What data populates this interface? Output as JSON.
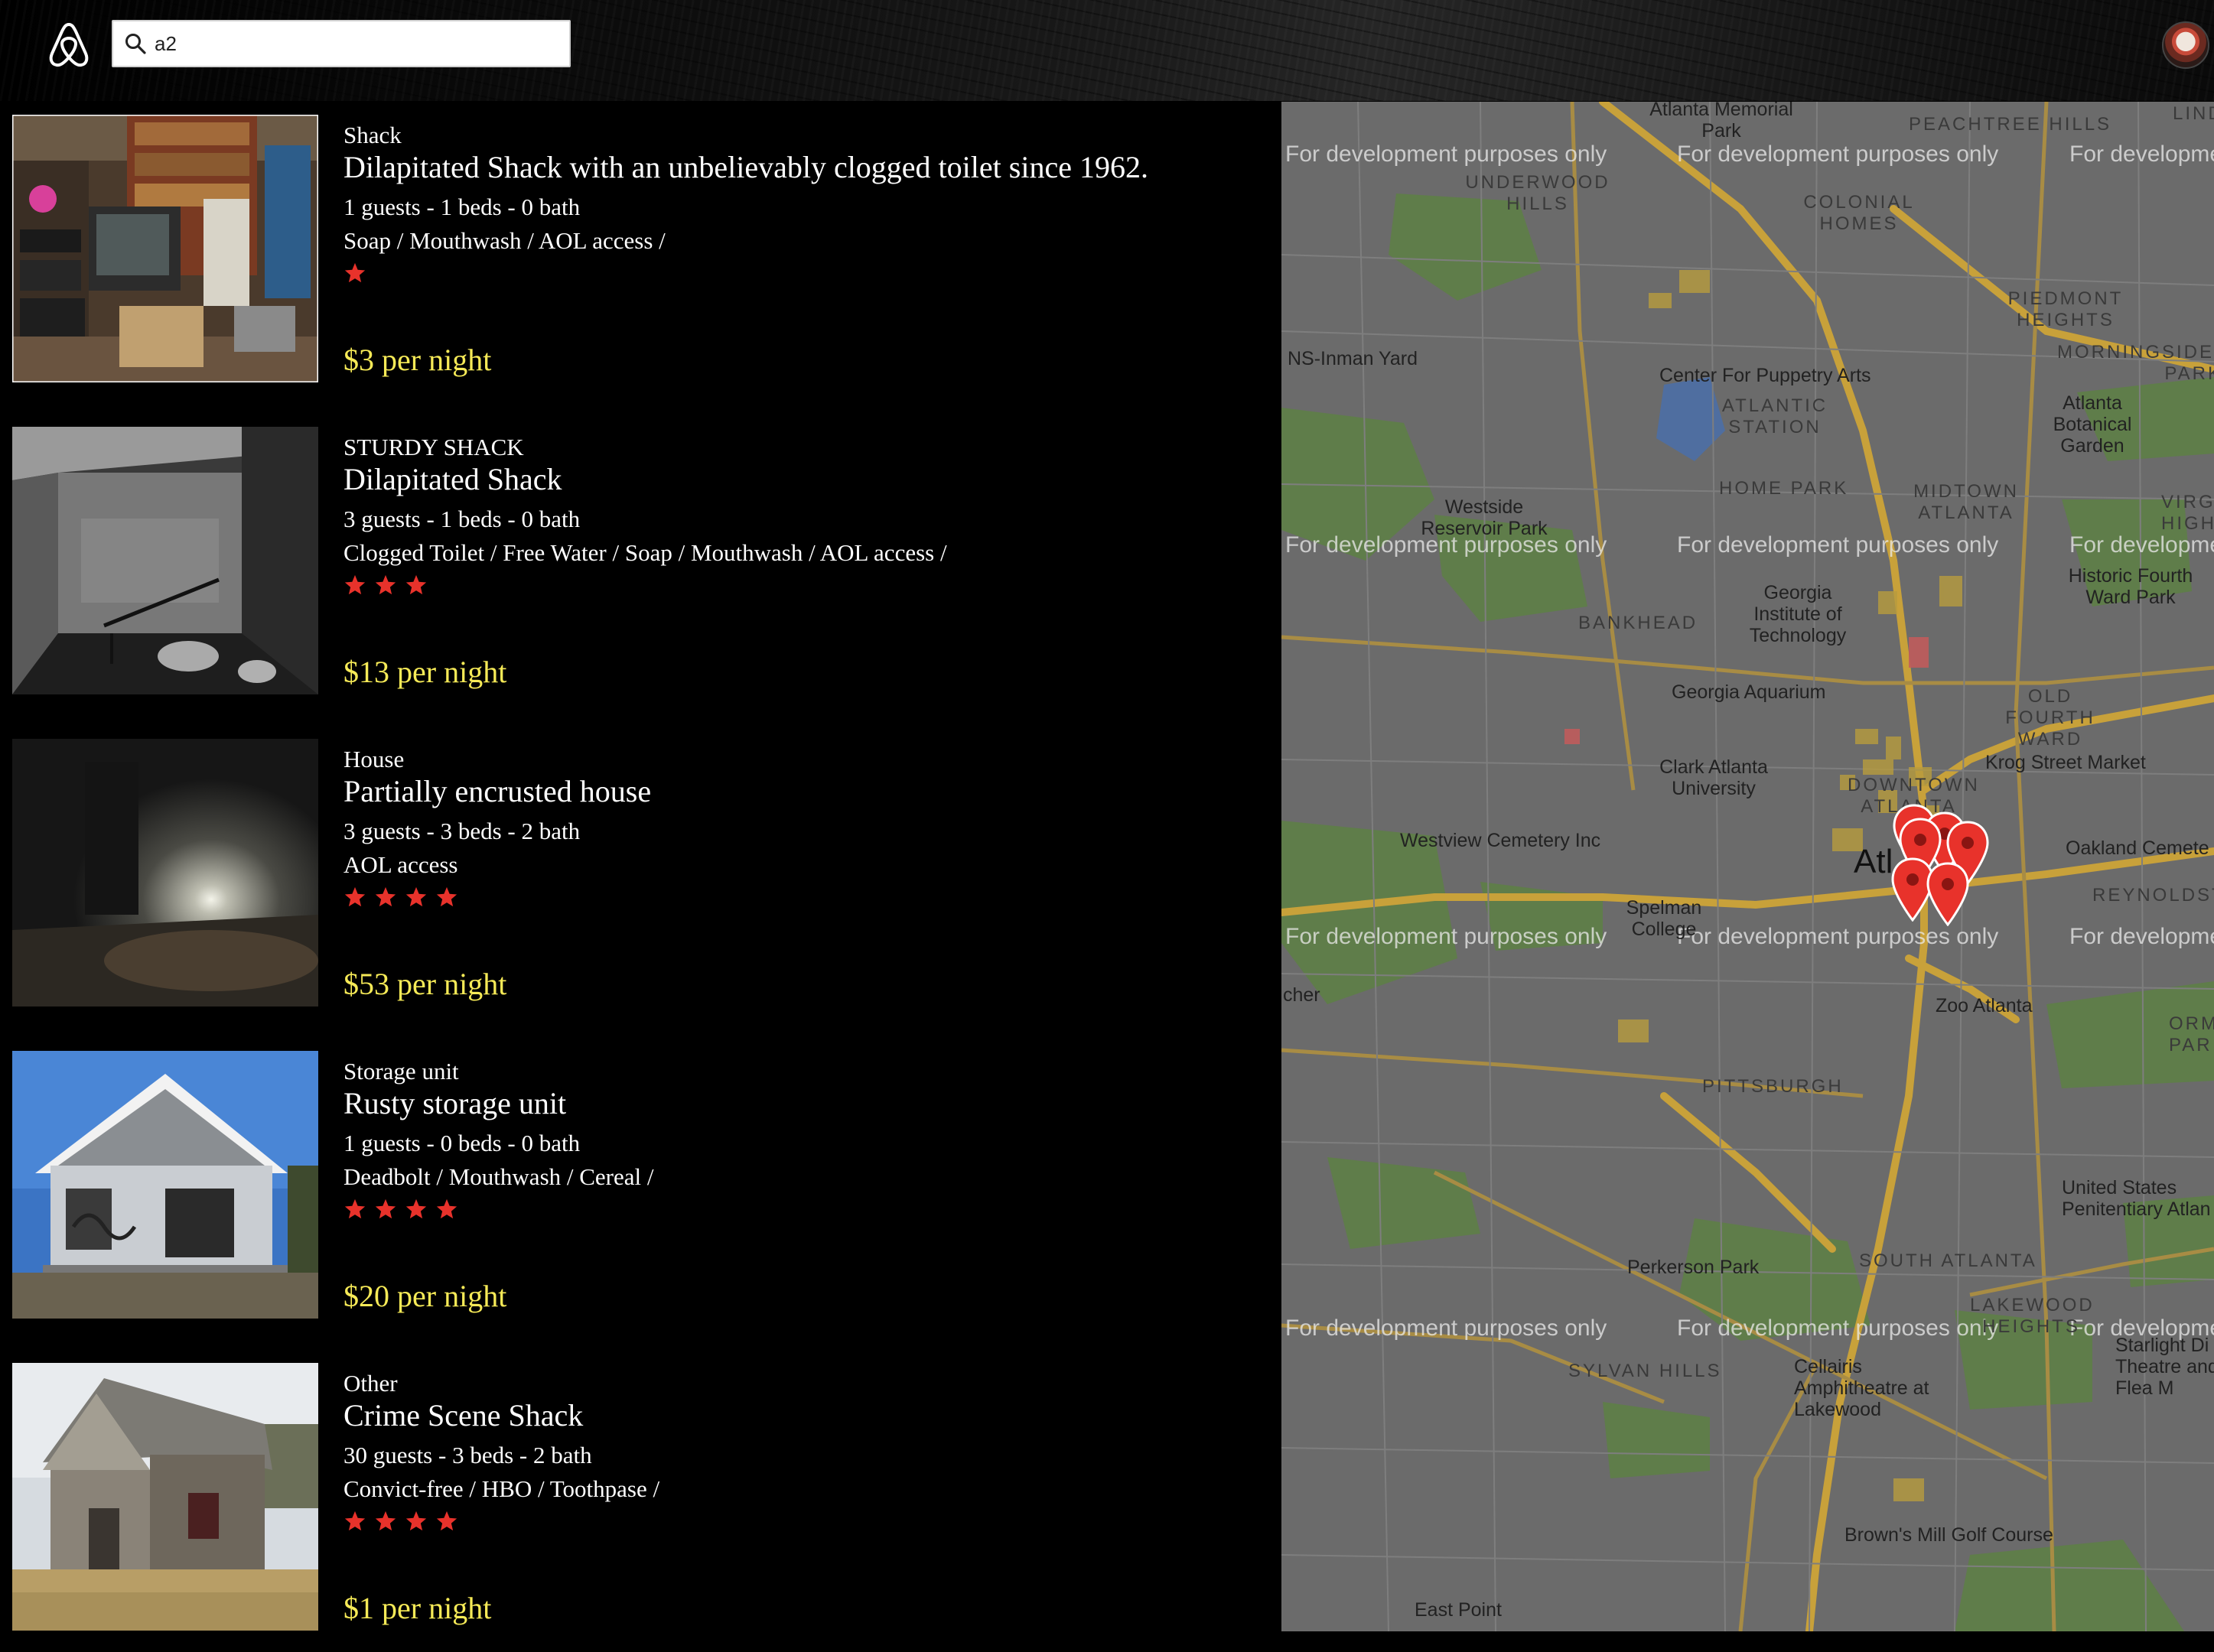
{
  "header": {
    "search": {
      "value": "a2",
      "placeholder": ""
    }
  },
  "icons": {
    "logo": "airbnb-logo-icon",
    "search": "search-icon",
    "avatar": "user-avatar",
    "star": "star-icon",
    "pin": "map-marker-icon"
  },
  "colors": {
    "background": "#000000",
    "price": "#f6ea57",
    "star": "#e8322b",
    "map_base": "#6b6b6b",
    "map_park": "#5f7d4a",
    "map_road": "#c8a13a",
    "pin": "#e8322b"
  },
  "listings": [
    {
      "type": "Shack",
      "title": "Dilapitated Shack with an unbelievably clogged toilet since 1962.",
      "details": "1 guests - 1 beds - 0 bath",
      "amenities": "Soap / Mouthwash / AOL access /",
      "rating": 1,
      "price": "$3 per night",
      "photo": "cluttered-room-photo"
    },
    {
      "type": "STURDY SHACK",
      "title": "Dilapitated Shack",
      "details": "3 guests - 1 beds - 0 bath",
      "amenities": "Clogged Toilet / Free Water / Soap / Mouthwash / AOL access /",
      "rating": 3,
      "price": "$13 per night",
      "photo": "concrete-basement-photo"
    },
    {
      "type": "House",
      "title": "Partially encrusted house",
      "details": "3 guests - 3 beds - 2 bath",
      "amenities": "AOL access",
      "rating": 4,
      "price": "$53 per night",
      "photo": "dark-room-photo"
    },
    {
      "type": "Storage unit",
      "title": "Rusty storage unit",
      "details": "1 guests - 0 beds - 0 bath",
      "amenities": "Deadbolt / Mouthwash / Cereal /",
      "rating": 4,
      "price": "$20 per night",
      "photo": "abandoned-house-photo"
    },
    {
      "type": "Other",
      "title": "Crime Scene Shack",
      "details": "30 guests - 3 beds - 2 bath",
      "amenities": "Convict-free / HBO / Toothpase /",
      "rating": 4,
      "price": "$1 per night",
      "photo": "wooden-shack-photo"
    }
  ],
  "map": {
    "watermark": "For development purposes only",
    "labels": {
      "memorial_park": "Atlanta Memorial Park",
      "peachtree_hills": "PEACHTREE HILLS",
      "lindridge": "LINDRI",
      "underwood_hills": "UNDERWOOD HILLS",
      "colonial_homes": "COLONIAL HOMES",
      "piedmont_heights": "PIEDMONT HEIGHTS",
      "morningside": "MORNINGSIDE-PARK",
      "ns_inman": "NS-Inman Yard",
      "puppetry": "Center For Puppetry Arts",
      "atlantic_station": "ATLANTIC STATION",
      "botanical": "Atlanta Botanical Garden",
      "home_park": "HOME PARK",
      "midtown": "MIDTOWN ATLANTA",
      "virginia_highland": "VIRGIN HIGHLA",
      "westside": "Westside Reservoir Park",
      "georgia_tech": "Georgia Institute of Technology",
      "historic_fourth": "Historic Fourth Ward Park",
      "bankhead": "BANKHEAD",
      "aquarium": "Georgia Aquarium",
      "old_fourth": "OLD FOURTH WARD",
      "clark": "Clark Atlanta University",
      "downtown": "DOWNTOWN ATLANTA",
      "krog": "Krog Street Market",
      "westview": "Westview Cemetery Inc",
      "oakland": "Oakland Cemete",
      "reynolds": "REYNOLDST",
      "spelman": "Spelman College",
      "atlanta": "Atl",
      "archer": "cher",
      "zoo": "Zoo Atlanta",
      "ormewood": "ORMEW PAR",
      "pittsburgh": "PITTSBURGH",
      "penitentiary": "United States Penitentiary Atlan",
      "south_atlanta": "SOUTH ATLANTA",
      "perkerson": "Perkerson Park",
      "lakewood": "LAKEWOOD HEIGHTS",
      "sylvan": "SYLVAN HILLS",
      "cellairis": "Cellairis Amphitheatre at Lakewood",
      "starlight": "Starlight Di Theatre and Flea M",
      "browns_mill": "Brown's Mill Golf Course",
      "east_point": "East Point"
    },
    "marker_count": 6
  }
}
